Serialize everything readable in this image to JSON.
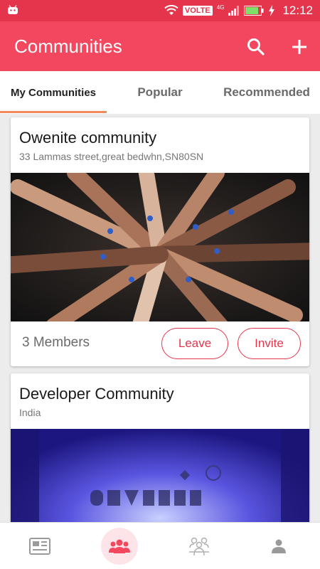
{
  "status_bar": {
    "network_label": "VOLTE",
    "signal_label": "4G",
    "time": "12:12"
  },
  "app_bar": {
    "title": "Communities",
    "icons": [
      "search-icon",
      "add-icon"
    ]
  },
  "tabs": [
    {
      "label": "My Communities",
      "active": true
    },
    {
      "label": "Popular",
      "active": false
    },
    {
      "label": "Recommended",
      "active": false
    }
  ],
  "communities": [
    {
      "name": "Owenite community",
      "address": "33 Lammas street,great bedwhn,SN80SN",
      "image_description": "hands-stacked-photo",
      "members": "3 Members",
      "leave_label": "Leave",
      "invite_label": "Invite"
    },
    {
      "name": "Developer Community",
      "address": "India",
      "image_description": "devfest-stage-photo"
    }
  ],
  "bottom_nav": [
    {
      "icon": "news-icon",
      "active": false
    },
    {
      "icon": "communities-icon",
      "active": true
    },
    {
      "icon": "events-icon",
      "active": false
    },
    {
      "icon": "profile-icon",
      "active": false
    }
  ],
  "colors": {
    "primary": "#f2475f",
    "status_bar": "#e4354d",
    "tab_indicator": "#f28a5a",
    "active_nav_bg": "#fde4e8"
  }
}
